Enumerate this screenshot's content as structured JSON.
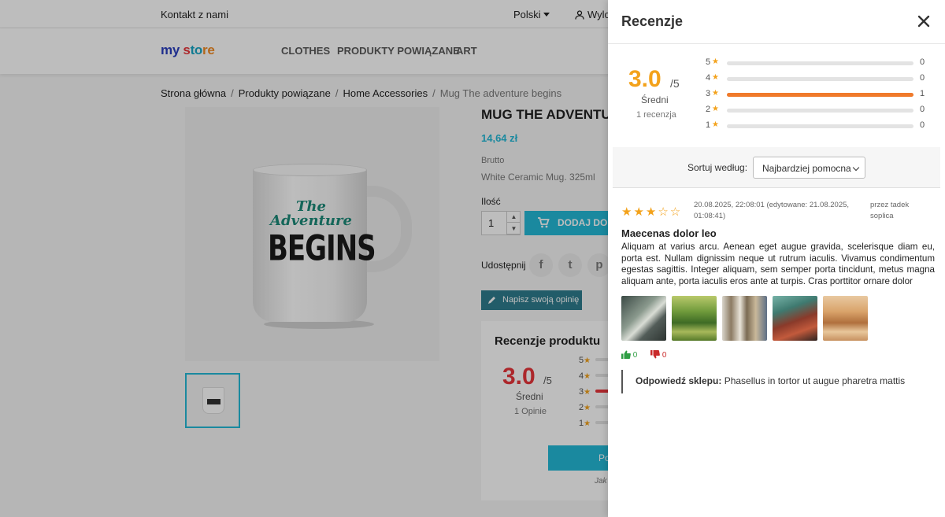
{
  "store": {
    "topbar": {
      "contact": "Kontakt z nami",
      "language": "Polski",
      "login": "Wylo"
    },
    "logo": {
      "part1": "my",
      "part2": " s",
      "part3": "to",
      "part4": "re"
    },
    "menu": [
      "CLOTHES",
      "PRODUKTY POWIĄZANE",
      "ART"
    ],
    "breadcrumb": [
      "Strona główna",
      "Produkty powiązane",
      "Home Accessories",
      "Mug The adventure begins"
    ],
    "mug_print": {
      "line1": "The",
      "line2": "Adventure",
      "line3": "BEGINS"
    },
    "product": {
      "title": "MUG THE ADVENTURE BEGINS",
      "price": "14,64 zł",
      "tax_label": "Brutto",
      "description": "White Ceramic Mug. 325ml",
      "qty_label": "Ilość",
      "qty_value": "1",
      "add_to_cart": "DODAJ DO KOSZYKA",
      "share_label": "Udostępnij",
      "write_review": "Napisz swoją opinię"
    },
    "reviews_box": {
      "title": "Recenzje produktu",
      "average": "3.0",
      "max": "/5",
      "average_label": "Średni",
      "count": "1 Opinie",
      "rows": [
        {
          "stars": "5",
          "filled": false
        },
        {
          "stars": "4",
          "filled": false
        },
        {
          "stars": "3",
          "filled": true
        },
        {
          "stars": "2",
          "filled": false
        },
        {
          "stars": "1",
          "filled": false
        }
      ],
      "button": "Pokaż wszystkie recenzje",
      "how": "Jak"
    }
  },
  "drawer": {
    "title": "Recenzje",
    "summary": {
      "average": "3.0",
      "max": "/5",
      "average_label": "Średni",
      "count": "1 recenzja",
      "distribution": [
        {
          "stars": "5",
          "count": "0",
          "fraction": 0
        },
        {
          "stars": "4",
          "count": "0",
          "fraction": 0
        },
        {
          "stars": "3",
          "count": "1",
          "fraction": 1
        },
        {
          "stars": "2",
          "count": "0",
          "fraction": 0
        },
        {
          "stars": "1",
          "count": "0",
          "fraction": 0
        }
      ]
    },
    "sort": {
      "label": "Sortuj według:",
      "selected": "Najbardziej pomocna"
    },
    "review": {
      "rating": 3,
      "stars": "★★★☆☆",
      "date": "20.08.2025, 22:08:01 (edytowane: 21.08.2025, 01:08:41)",
      "author": "przez tadek soplica",
      "title": "Maecenas dolor leo",
      "body": "Aliquam at varius arcu. Aenean eget augue gravida, scelerisque diam eu, porta est. Nullam dignissim neque ut rutrum iaculis. Vivamus condimentum egestas sagittis. Integer aliquam, sem semper porta tincidunt, metus magna aliquam ante, porta iaculis eros ante at turpis. Cras porttitor ornare dolor",
      "upvotes": "0",
      "downvotes": "0",
      "shop_reply_label": "Odpowiedź sklepu:",
      "shop_reply_text": "Phasellus in tortor ut augue pharetra mattis"
    }
  },
  "colors": {
    "accent": "#24b9d7",
    "star": "#f3a21b",
    "bar_fill": "#f07a2b",
    "average_store": "#e9353a"
  }
}
